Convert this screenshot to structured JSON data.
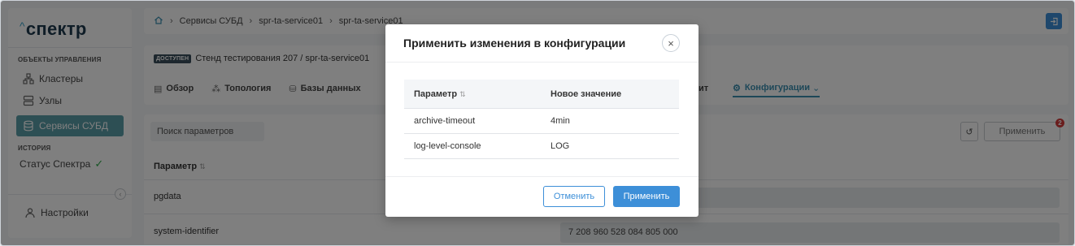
{
  "app": {
    "logo": "спектр",
    "logo_caret": "^"
  },
  "sidebar": {
    "section_management": "ОБЪЕКТЫ УПРАВЛЕНИЯ",
    "items": [
      {
        "label": "Кластеры",
        "icon": "clusters-icon"
      },
      {
        "label": "Узлы",
        "icon": "nodes-icon"
      },
      {
        "label": "Сервисы СУБД",
        "icon": "dbms-services-icon",
        "active": true
      }
    ],
    "section_history": "ИСТОРИЯ",
    "status_label": "Статус Спектра",
    "status_icon": "check-icon",
    "settings_label": "Настройки"
  },
  "breadcrumb": {
    "items": [
      "Сервисы СУБД",
      "spr-ta-service01",
      "spr-ta-service01"
    ]
  },
  "service": {
    "status_badge": "ДОСТУПЕН",
    "title": "Стенд тестирования 207 / spr-ta-service01",
    "tabs": [
      "Обзор",
      "Топология",
      "Базы данных"
    ],
    "tab_audit": "дит",
    "tab_config": "Конфигурации"
  },
  "params": {
    "search_placeholder": "Поиск параметров",
    "apply_label": "Применить",
    "pending_count": "2",
    "column_param": "Параметр",
    "sort_icon": "⇅",
    "rows": [
      {
        "name": "pgdata",
        "value": ""
      },
      {
        "name": "system-identifier",
        "value": "7 208 960 528 084 805 000"
      }
    ]
  },
  "modal": {
    "title": "Применить изменения в конфигурации",
    "col_param": "Параметр",
    "col_new_value": "Новое значение",
    "rows": [
      {
        "param": "archive-timeout",
        "value": "4min"
      },
      {
        "param": "log-level-console",
        "value": "LOG"
      }
    ],
    "cancel_label": "Отменить",
    "apply_label": "Применить"
  },
  "colors": {
    "accent": "#3d8fd8",
    "active_nav": "#5b9ea8",
    "badge_bg": "#3a4f5c",
    "status_ok": "#2eaa4a",
    "counter": "#d43b3b"
  }
}
